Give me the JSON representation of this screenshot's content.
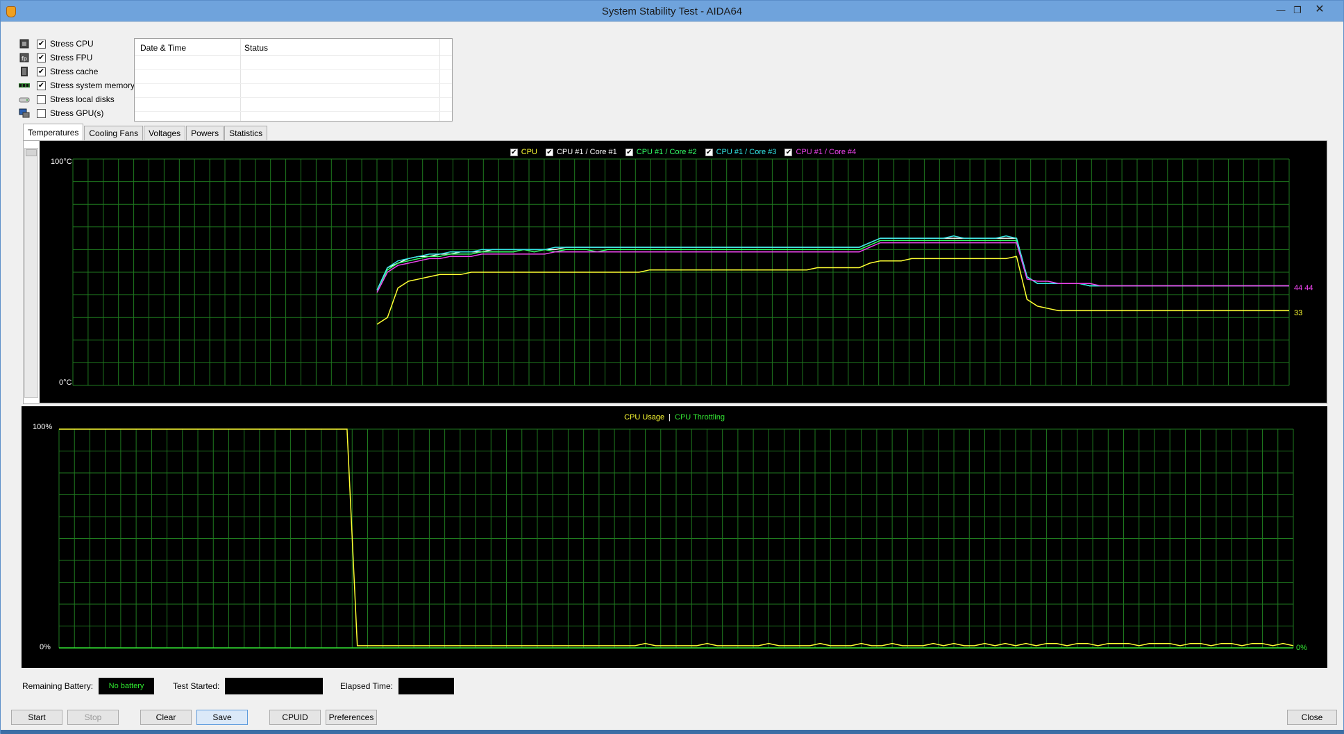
{
  "window": {
    "title": "System Stability Test - AIDA64",
    "close_glyph": "✕",
    "min_glyph": "—",
    "restore_glyph": "❐"
  },
  "stress_options": [
    {
      "label": "Stress CPU",
      "checked": true,
      "icon": "cpu-icon"
    },
    {
      "label": "Stress FPU",
      "checked": true,
      "icon": "fpu-icon"
    },
    {
      "label": "Stress cache",
      "checked": true,
      "icon": "cache-icon"
    },
    {
      "label": "Stress system memory",
      "checked": true,
      "icon": "memory-icon"
    },
    {
      "label": "Stress local disks",
      "checked": false,
      "icon": "disk-icon"
    },
    {
      "label": "Stress GPU(s)",
      "checked": false,
      "icon": "gpu-icon"
    }
  ],
  "log": {
    "col_date": "Date & Time",
    "col_status": "Status"
  },
  "tabs": [
    "Temperatures",
    "Cooling Fans",
    "Voltages",
    "Powers",
    "Statistics"
  ],
  "temp_chart": {
    "legend": [
      {
        "label": "CPU",
        "color": "#ffff33"
      },
      {
        "label": "CPU #1 / Core #1",
        "color": "#ffffff"
      },
      {
        "label": "CPU #1 / Core #2",
        "color": "#33ff66"
      },
      {
        "label": "CPU #1 / Core #3",
        "color": "#33e6e6"
      },
      {
        "label": "CPU #1 / Core #4",
        "color": "#ee44ee"
      }
    ],
    "y_max_label": "100°C",
    "y_min_label": "0°C",
    "right_value_cores": "44 44",
    "right_value_cpu": "33"
  },
  "usage_chart": {
    "legend_usage": "CPU Usage",
    "separator": "|",
    "legend_throttling": "CPU Throttling",
    "y_max_label": "100%",
    "y_min_label": "0%",
    "right_value": "0%"
  },
  "bottom": {
    "remaining_battery_label": "Remaining Battery:",
    "remaining_battery_value": "No battery",
    "test_started_label": "Test Started:",
    "test_started_value": "",
    "elapsed_label": "Elapsed Time:",
    "elapsed_value": ""
  },
  "buttons": {
    "start": "Start",
    "stop": "Stop",
    "clear": "Clear",
    "save": "Save",
    "cpuid": "CPUID",
    "preferences": "Preferences",
    "close": "Close"
  },
  "chart_data": [
    {
      "type": "line",
      "legend_placement": "top-center",
      "grid": true,
      "ylim": [
        0,
        100
      ],
      "yunit": "°C",
      "series": [
        {
          "name": "CPU",
          "color": "#ffff33",
          "values": [
            null,
            null,
            null,
            null,
            null,
            null,
            null,
            null,
            null,
            null,
            null,
            null,
            null,
            null,
            null,
            null,
            null,
            null,
            null,
            null,
            null,
            null,
            null,
            null,
            null,
            null,
            null,
            null,
            null,
            27,
            30,
            43,
            46,
            47,
            48,
            49,
            49,
            49,
            50,
            50,
            50,
            50,
            50,
            50,
            50,
            50,
            50,
            50,
            50,
            50,
            50,
            50,
            50,
            50,
            50,
            51,
            51,
            51,
            51,
            51,
            51,
            51,
            51,
            51,
            51,
            51,
            51,
            51,
            51,
            51,
            51,
            52,
            52,
            52,
            52,
            52,
            54,
            55,
            55,
            55,
            56,
            56,
            56,
            56,
            56,
            56,
            56,
            56,
            56,
            56,
            57,
            38,
            35,
            34,
            33,
            33,
            33,
            33,
            33,
            33,
            33,
            33,
            33,
            33,
            33,
            33,
            33,
            33,
            33,
            33,
            33,
            33,
            33,
            33,
            33,
            33,
            33
          ]
        },
        {
          "name": "CPU #1 / Core #1",
          "color": "#ffffff",
          "values": [
            null,
            null,
            null,
            null,
            null,
            null,
            null,
            null,
            null,
            null,
            null,
            null,
            null,
            null,
            null,
            null,
            null,
            null,
            null,
            null,
            null,
            null,
            null,
            null,
            null,
            null,
            null,
            null,
            null,
            42,
            52,
            54,
            56,
            57,
            57,
            58,
            58,
            59,
            59,
            59,
            60,
            60,
            60,
            60,
            60,
            60,
            60,
            61,
            61,
            61,
            61,
            61,
            61,
            61,
            61,
            61,
            61,
            61,
            61,
            61,
            61,
            61,
            61,
            61,
            61,
            61,
            61,
            61,
            61,
            61,
            61,
            61,
            61,
            61,
            61,
            61,
            63,
            65,
            65,
            65,
            65,
            65,
            65,
            65,
            65,
            65,
            65,
            65,
            65,
            65,
            65,
            48,
            45,
            45,
            45,
            45,
            45,
            44,
            44,
            44,
            44,
            44,
            44,
            44,
            44,
            44,
            44,
            44,
            44,
            44,
            44,
            44,
            44,
            44,
            44,
            44,
            44
          ]
        },
        {
          "name": "CPU #1 / Core #2",
          "color": "#33ff66",
          "values": [
            null,
            null,
            null,
            null,
            null,
            null,
            null,
            null,
            null,
            null,
            null,
            null,
            null,
            null,
            null,
            null,
            null,
            null,
            null,
            null,
            null,
            null,
            null,
            null,
            null,
            null,
            null,
            null,
            null,
            42,
            51,
            54,
            55,
            56,
            57,
            57,
            58,
            58,
            58,
            59,
            59,
            59,
            59,
            60,
            59,
            60,
            59,
            60,
            60,
            60,
            59,
            60,
            60,
            60,
            60,
            60,
            60,
            60,
            60,
            60,
            60,
            60,
            60,
            60,
            60,
            60,
            60,
            60,
            60,
            60,
            60,
            60,
            60,
            60,
            60,
            60,
            62,
            64,
            64,
            64,
            64,
            64,
            64,
            64,
            64,
            64,
            64,
            64,
            64,
            64,
            64,
            48,
            45,
            45,
            45,
            45,
            45,
            44,
            44,
            44,
            44,
            44,
            44,
            44,
            44,
            44,
            44,
            44,
            44,
            44,
            44,
            44,
            44,
            44,
            44,
            44,
            44
          ]
        },
        {
          "name": "CPU #1 / Core #3",
          "color": "#33e6e6",
          "values": [
            null,
            null,
            null,
            null,
            null,
            null,
            null,
            null,
            null,
            null,
            null,
            null,
            null,
            null,
            null,
            null,
            null,
            null,
            null,
            null,
            null,
            null,
            null,
            null,
            null,
            null,
            null,
            null,
            null,
            42,
            52,
            55,
            56,
            57,
            58,
            58,
            59,
            59,
            59,
            60,
            60,
            60,
            60,
            60,
            60,
            60,
            61,
            61,
            61,
            61,
            61,
            61,
            61,
            61,
            61,
            61,
            61,
            61,
            61,
            61,
            61,
            61,
            61,
            61,
            61,
            61,
            61,
            61,
            61,
            61,
            61,
            61,
            61,
            61,
            61,
            61,
            63,
            65,
            65,
            65,
            65,
            65,
            65,
            65,
            66,
            65,
            65,
            65,
            65,
            66,
            65,
            48,
            45,
            45,
            45,
            45,
            45,
            44,
            44,
            44,
            44,
            44,
            44,
            44,
            44,
            44,
            44,
            44,
            44,
            44,
            44,
            44,
            44,
            44,
            44,
            44,
            44
          ]
        },
        {
          "name": "CPU #1 / Core #4",
          "color": "#ee44ee",
          "values": [
            null,
            null,
            null,
            null,
            null,
            null,
            null,
            null,
            null,
            null,
            null,
            null,
            null,
            null,
            null,
            null,
            null,
            null,
            null,
            null,
            null,
            null,
            null,
            null,
            null,
            null,
            null,
            null,
            null,
            41,
            50,
            53,
            54,
            55,
            56,
            56,
            57,
            57,
            57,
            58,
            58,
            58,
            58,
            58,
            58,
            58,
            59,
            59,
            59,
            59,
            59,
            59,
            59,
            59,
            59,
            59,
            59,
            59,
            59,
            59,
            59,
            59,
            59,
            59,
            59,
            59,
            59,
            59,
            59,
            59,
            59,
            59,
            59,
            59,
            59,
            59,
            61,
            63,
            63,
            63,
            63,
            63,
            63,
            63,
            63,
            63,
            63,
            63,
            63,
            63,
            63,
            47,
            46,
            46,
            45,
            45,
            45,
            45,
            44,
            44,
            44,
            44,
            44,
            44,
            44,
            44,
            44,
            44,
            44,
            44,
            44,
            44,
            44,
            44,
            44,
            44,
            44
          ]
        }
      ]
    },
    {
      "type": "line",
      "legend_placement": "top-center",
      "grid": true,
      "ylim": [
        0,
        100
      ],
      "yunit": "%",
      "series": [
        {
          "name": "CPU Usage",
          "color": "#ffff33",
          "values": [
            100,
            100,
            100,
            100,
            100,
            100,
            100,
            100,
            100,
            100,
            100,
            100,
            100,
            100,
            100,
            100,
            100,
            100,
            100,
            100,
            100,
            100,
            100,
            100,
            100,
            100,
            100,
            100,
            100,
            1,
            1,
            1,
            1,
            1,
            1,
            1,
            1,
            1,
            1,
            1,
            1,
            1,
            1,
            1,
            1,
            1,
            1,
            1,
            1,
            1,
            1,
            1,
            1,
            1,
            1,
            1,
            1,
            2,
            1,
            1,
            1,
            1,
            1,
            2,
            1,
            1,
            1,
            1,
            1,
            2,
            1,
            1,
            1,
            1,
            2,
            1,
            1,
            1,
            2,
            1,
            1,
            2,
            1,
            1,
            1,
            2,
            1,
            2,
            1,
            1,
            2,
            1,
            2,
            1,
            2,
            1,
            2,
            2,
            1,
            2,
            2,
            1,
            2,
            2,
            2,
            1,
            2,
            2,
            2,
            1,
            2,
            2,
            1,
            2,
            2,
            1,
            2,
            2,
            1,
            2,
            1
          ]
        },
        {
          "name": "CPU Throttling",
          "color": "#33e633",
          "values": [
            0,
            0,
            0,
            0,
            0,
            0,
            0,
            0,
            0,
            0,
            0,
            0,
            0,
            0,
            0,
            0,
            0,
            0,
            0,
            0,
            0,
            0,
            0,
            0,
            0,
            0,
            0,
            0,
            0,
            0,
            0,
            0,
            0,
            0,
            0,
            0,
            0,
            0,
            0,
            0,
            0,
            0,
            0,
            0,
            0,
            0,
            0,
            0,
            0,
            0,
            0,
            0,
            0,
            0,
            0,
            0,
            0,
            0,
            0,
            0,
            0,
            0,
            0,
            0,
            0,
            0,
            0,
            0,
            0,
            0,
            0,
            0,
            0,
            0,
            0,
            0,
            0,
            0,
            0,
            0,
            0,
            0,
            0,
            0,
            0,
            0,
            0,
            0,
            0,
            0,
            0,
            0,
            0,
            0,
            0,
            0,
            0,
            0,
            0,
            0,
            0,
            0,
            0,
            0,
            0,
            0,
            0,
            0,
            0,
            0,
            0,
            0,
            0,
            0,
            0,
            0,
            0,
            0,
            0,
            0,
            0
          ]
        }
      ]
    }
  ]
}
